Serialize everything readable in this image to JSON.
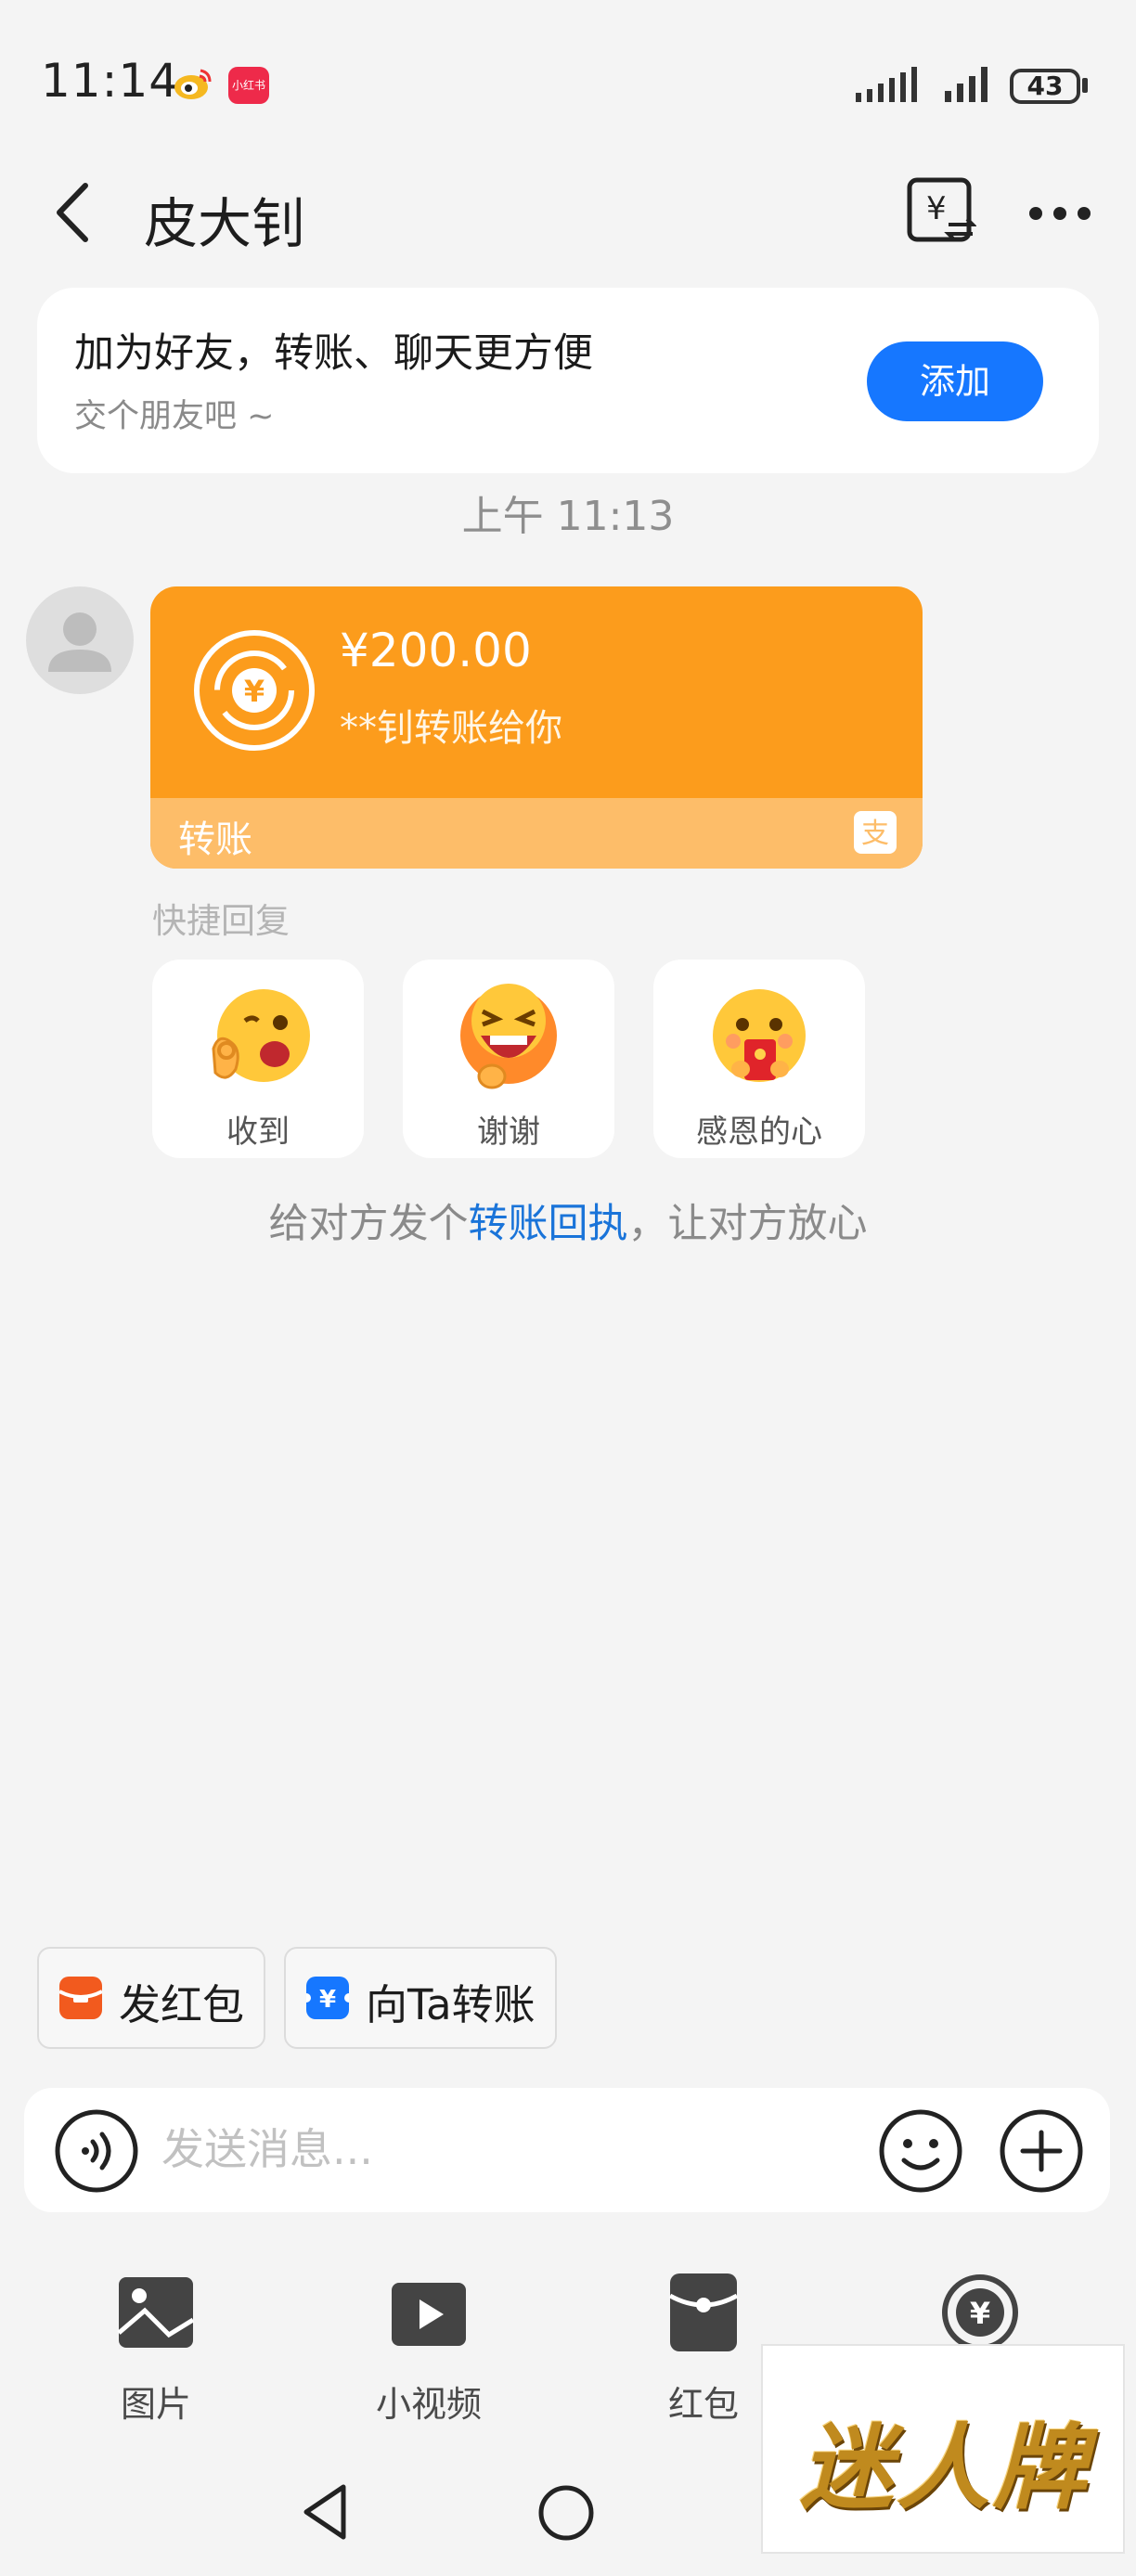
{
  "status_bar": {
    "time": "11:14",
    "xhs_label": "小红书",
    "battery": "43"
  },
  "header": {
    "title": "皮大钊",
    "back_icon": "chevron-left-icon",
    "bill_icon": "yuan-exchange-icon",
    "more_icon": "more-horizontal-icon"
  },
  "friend_card": {
    "title": "加为好友，转账、聊天更方便",
    "subtitle": "交个朋友吧 ~",
    "button_label": "添加",
    "button_color": "#1677ff"
  },
  "timestamp": "上午 11:13",
  "transfer_message": {
    "amount": "¥200.00",
    "description": "**钊转账给你",
    "label": "转账",
    "card_color": "#fc9c1c",
    "footer_color": "#fdbd69"
  },
  "quick_reply": {
    "title": "快捷回复",
    "options": [
      {
        "label": "收到",
        "icon": "ok-hand-emoji-icon"
      },
      {
        "label": "谢谢",
        "icon": "laughing-emoji-icon"
      },
      {
        "label": "感恩的心",
        "icon": "red-envelope-emoji-icon"
      }
    ]
  },
  "receipt_hint": {
    "prefix": "给对方发个",
    "link": "转账回执",
    "suffix": "，让对方放心"
  },
  "shortcuts": [
    {
      "label": "发红包",
      "icon": "red-packet-icon",
      "color": "#f25a1e"
    },
    {
      "label": "向Ta转账",
      "icon": "transfer-yuan-icon",
      "color": "#1677ff"
    }
  ],
  "input": {
    "placeholder": "发送消息..."
  },
  "tools": [
    {
      "label": "图片",
      "icon": "image-icon"
    },
    {
      "label": "小视频",
      "icon": "video-icon"
    },
    {
      "label": "红包",
      "icon": "red-envelope-icon"
    },
    {
      "label": "",
      "icon": "transfer-icon"
    }
  ],
  "watermark": {
    "text": "迷人牌"
  }
}
